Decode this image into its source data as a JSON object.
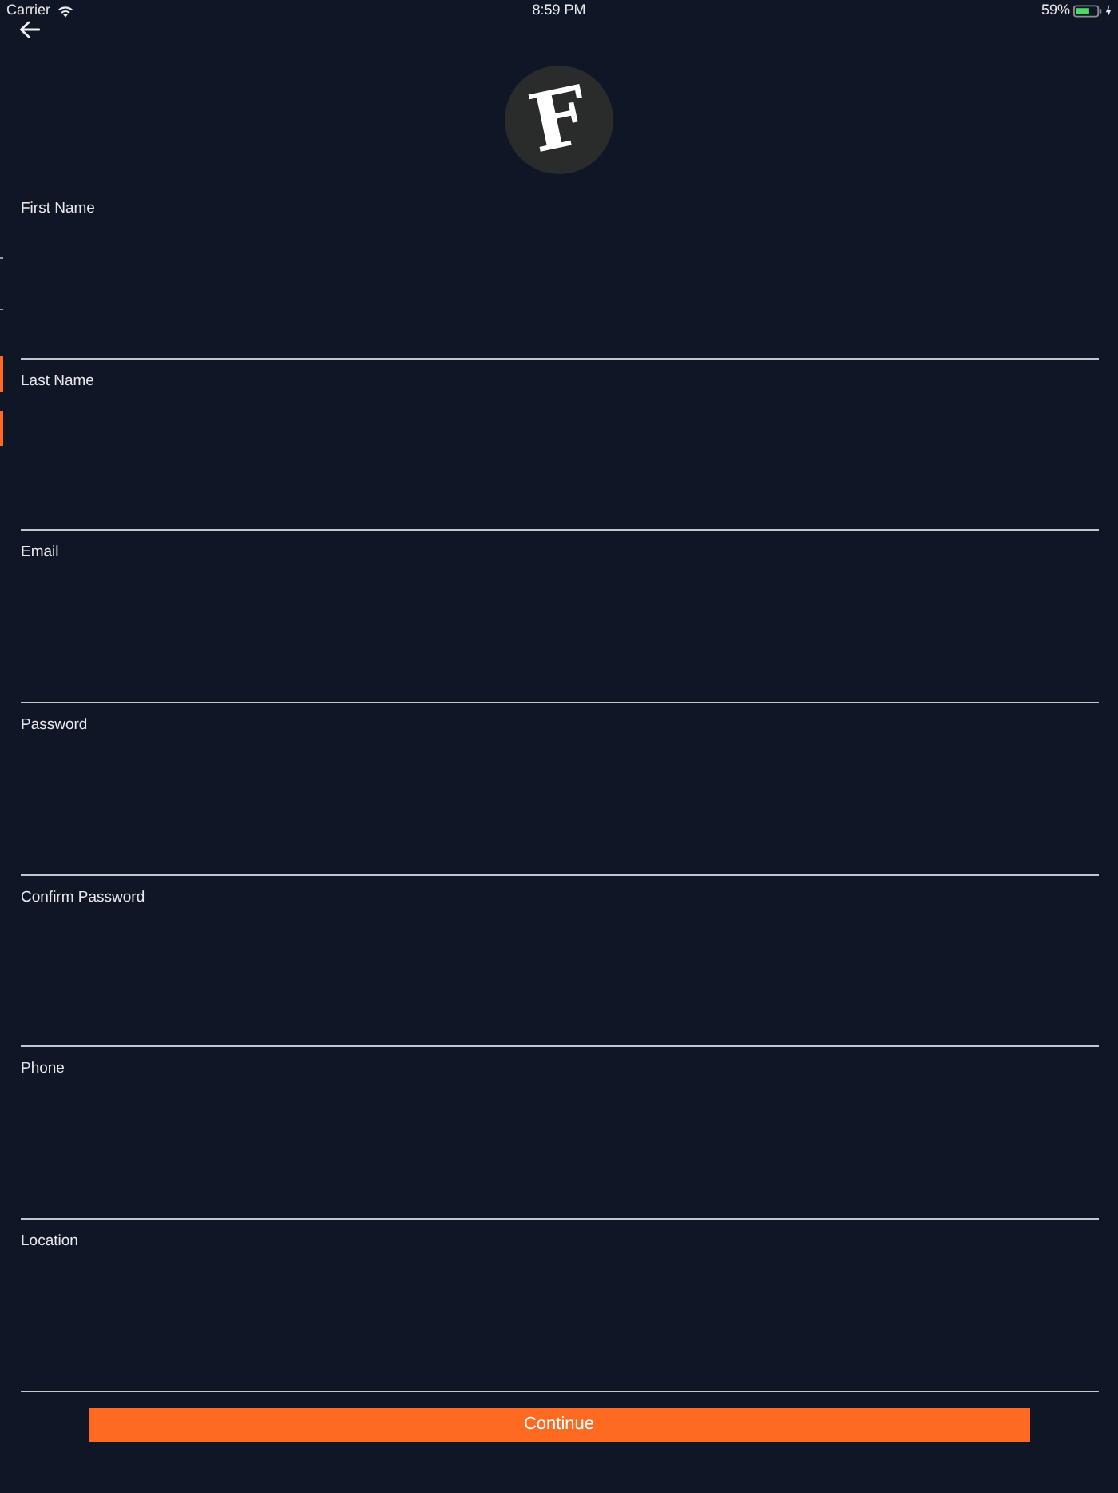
{
  "status_bar": {
    "carrier": "Carrier",
    "time": "8:59 PM",
    "battery": "59%"
  },
  "logo": {
    "letter": "F"
  },
  "fields": [
    {
      "label": "First Name"
    },
    {
      "label": "Last Name"
    },
    {
      "label": "Email"
    },
    {
      "label": "Password"
    },
    {
      "label": "Confirm Password"
    },
    {
      "label": "Phone"
    },
    {
      "label": "Location"
    }
  ],
  "continue_button": {
    "label": "Continue"
  }
}
